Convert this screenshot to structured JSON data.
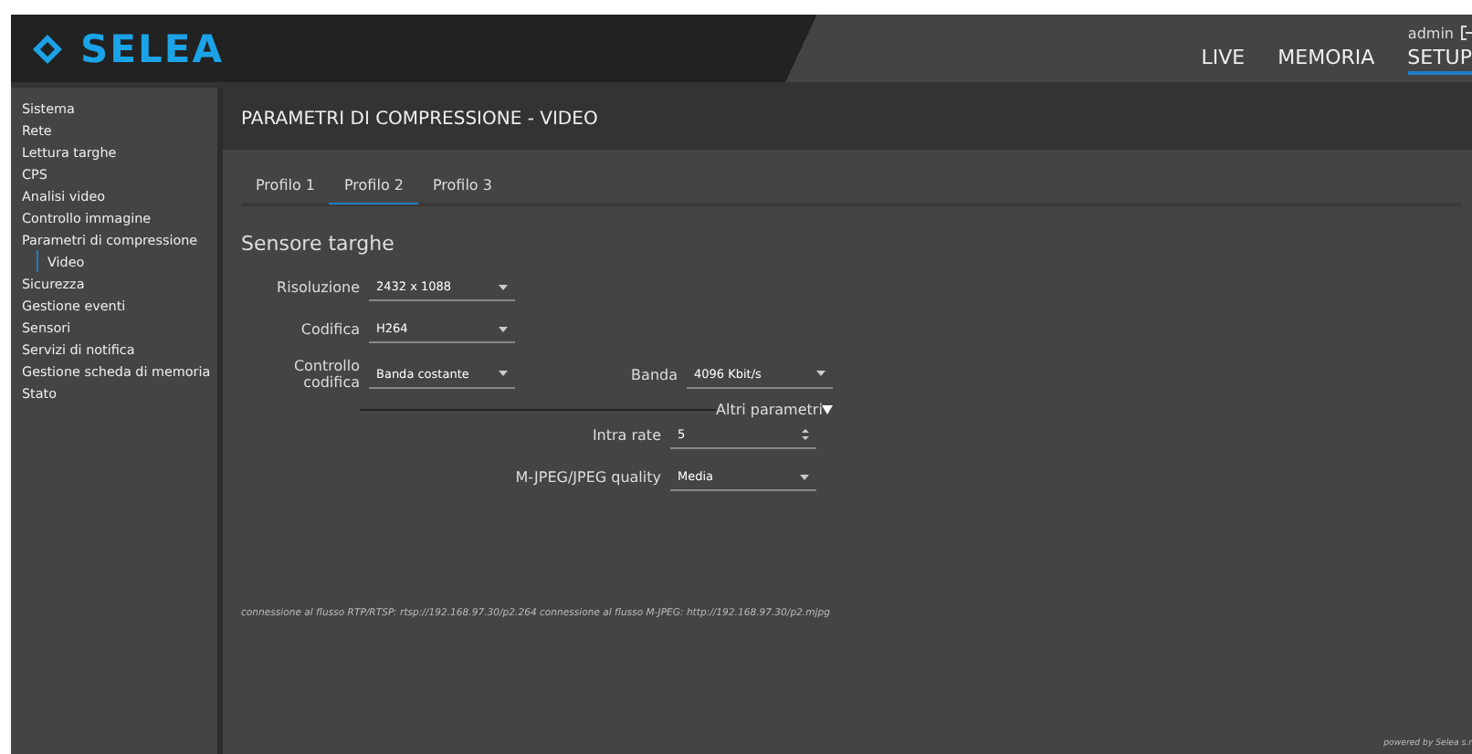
{
  "header": {
    "logo": "SELEA",
    "user": "admin",
    "nav": [
      {
        "label": "LIVE",
        "selected": false
      },
      {
        "label": "MEMORIA",
        "selected": false
      },
      {
        "label": "SETUP",
        "selected": true
      }
    ]
  },
  "sidebar": {
    "items": [
      {
        "label": "Sistema",
        "selected": false
      },
      {
        "label": "Rete",
        "selected": false
      },
      {
        "label": "Lettura targhe",
        "selected": false
      },
      {
        "label": "CPS",
        "selected": false
      },
      {
        "label": "Analisi video",
        "selected": false
      },
      {
        "label": "Controllo immagine",
        "selected": false
      },
      {
        "label": "Parametri di compressione",
        "selected": false,
        "children": [
          {
            "label": "Video",
            "selected": true
          }
        ]
      },
      {
        "label": "Sicurezza",
        "selected": false
      },
      {
        "label": "Gestione eventi",
        "selected": false
      },
      {
        "label": "Sensori",
        "selected": false
      },
      {
        "label": "Servizi di notifica",
        "selected": false
      },
      {
        "label": "Gestione scheda di memoria",
        "selected": false
      },
      {
        "label": "Stato",
        "selected": false
      }
    ]
  },
  "page": {
    "title": "PARAMETRI DI COMPRESSIONE - VIDEO",
    "tabs": [
      {
        "label": "Profilo 1",
        "selected": false
      },
      {
        "label": "Profilo 2",
        "selected": true
      },
      {
        "label": "Profilo 3",
        "selected": false
      }
    ],
    "section": "Sensore targhe",
    "fields": [
      {
        "label": "Risoluzione",
        "value": "2432 x 1088",
        "kind": "select"
      },
      {
        "label": "Codifica",
        "value": "H264",
        "kind": "select"
      }
    ],
    "control": {
      "label": "Controllo codifica",
      "value": "Banda costante",
      "kind": "select"
    },
    "bandwidth": {
      "label": "Banda",
      "value": "4096 Kbit/s",
      "kind": "select"
    },
    "more": {
      "label": "Altri parametri",
      "expanded": true
    },
    "advanced": [
      {
        "label": "Intra rate",
        "value": "5",
        "kind": "spinner"
      },
      {
        "label": "M-JPEG/JPEG quality",
        "value": "Media",
        "kind": "select"
      }
    ],
    "streams": "connessione al flusso RTP/RTSP: rtsp://192.168.97.30/p2.264   connessione al flusso M-JPEG: http://192.168.97.30/p2.mjpg",
    "footer": "powered by Selea s.r"
  }
}
